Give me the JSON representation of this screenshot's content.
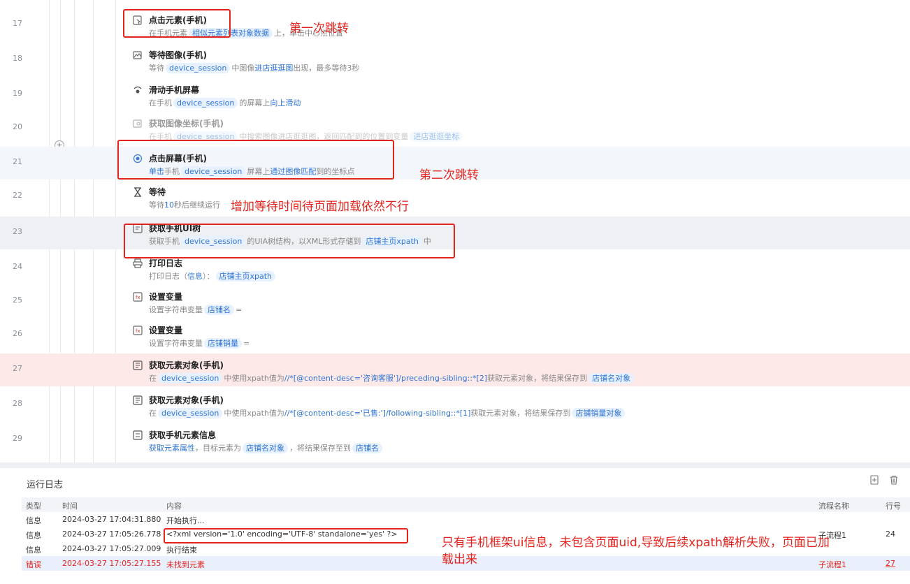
{
  "rows": [
    {
      "num": "17",
      "title": "点击元素(手机)",
      "desc_pre": "在手机元素",
      "tok1": "相似元素列表对象数据",
      "desc_post": "上，单击中心点位置"
    },
    {
      "num": "18",
      "title": "等待图像(手机)",
      "desc_pre": "等待",
      "tok1": "device_session",
      "desc_mid": "中图像",
      "kw1": "进店逛逛图",
      "desc_post": "出现，最多等待3秒"
    },
    {
      "num": "19",
      "title": "滑动手机屏幕",
      "desc_pre": "在手机",
      "tok1": "device_session",
      "desc_mid": "的屏幕上",
      "kw1": "向上滑动"
    },
    {
      "num": "20",
      "title": "获取图像坐标(手机)",
      "desc_pre": "在手机",
      "tok1": "device_session",
      "desc_mid": "中搜索图像进店逛逛图，返回匹配到的位置到变量",
      "tok2": "进店逛逛坐标"
    },
    {
      "num": "21",
      "title": "点击屏幕(手机)",
      "kw0": "单击",
      "desc_pre": "手机",
      "tok1": "device_session",
      "desc_mid": "屏幕上",
      "kw1": "通过图像匹配",
      "desc_post": "到的坐标点"
    },
    {
      "num": "22",
      "title": "等待",
      "desc_pre": "等待",
      "kw1": "10",
      "desc_post": "秒后继续运行"
    },
    {
      "num": "23",
      "title": "获取手机UI树",
      "desc_pre": "获取手机",
      "tok1": "device_session",
      "desc_mid": "的UIA树结构，以XML形式存储到",
      "tok2": "店铺主页xpath",
      "desc_post": "中"
    },
    {
      "num": "24",
      "title": "打印日志",
      "desc_pre": "打印日志（",
      "kw1": "信息",
      "desc_mid": "）：",
      "tok1": "店铺主页xpath"
    },
    {
      "num": "25",
      "title": "设置变量",
      "desc_pre": "设置字符串变量",
      "tok1": "店铺名",
      "desc_post": "="
    },
    {
      "num": "26",
      "title": "设置变量",
      "desc_pre": "设置字符串变量",
      "tok1": "店铺销量",
      "desc_post": "="
    },
    {
      "num": "27",
      "title": "获取元素对象(手机)",
      "desc_pre": "在",
      "tok1": "device_session",
      "desc_mid": "中使用xpath值为",
      "kw1": "//*[@content-desc='咨询客服']/preceding-sibling::*[2]",
      "desc_post": "获取元素对象，将结果保存到",
      "tok2": "店铺名对象"
    },
    {
      "num": "28",
      "title": "获取元素对象(手机)",
      "desc_pre": "在",
      "tok1": "device_session",
      "desc_mid": "中使用xpath值为",
      "kw1": "//*[@content-desc='已售:']/following-sibling::*[1]",
      "desc_post": "获取元素对象，将结果保存到",
      "tok2": "店铺销量对象"
    },
    {
      "num": "29",
      "title": "获取手机元素信息",
      "kw0": "获取元素属性",
      "desc_pre": "，目标元素为",
      "tok1": "店铺名对象",
      "desc_mid": "，将结果保存至到",
      "tok2": "店铺名"
    }
  ],
  "annotations": {
    "a1": "第一次跳转",
    "a2": "第二次跳转",
    "a3": "增加等待时间待页面加载依然不行",
    "a4_line1": "只有手机框架ui信息，未包含页面uid,导致后续xpath解析失败，页面已加",
    "a4_line2": "载出来"
  },
  "log": {
    "title": "运行日志",
    "headers": {
      "type": "类型",
      "time": "时间",
      "content": "内容",
      "flow": "流程名称",
      "line": "行号"
    },
    "rows": [
      {
        "type": "信息",
        "time": "2024-03-27 17:04:31.880",
        "content": "开始执行...",
        "flow": "",
        "line": ""
      },
      {
        "type": "信息",
        "time": "2024-03-27 17:05:26.778",
        "content": "<?xml version='1.0' encoding='UTF-8' standalone='yes' ?>",
        "flow": "子流程1",
        "line": "24"
      },
      {
        "type": "信息",
        "time": "2024-03-27 17:05:27.009",
        "content": "执行结束",
        "flow": "",
        "line": ""
      },
      {
        "type": "错误",
        "time": "2024-03-27 17:05:27.155",
        "content": "未找到元素",
        "flow": "子流程1",
        "line": "27"
      }
    ]
  },
  "colors": {
    "accent": "#2f74d6",
    "annotation": "#e5231d",
    "error_row": "#fde9e8"
  },
  "icons": [
    "click-element-icon",
    "wait-image-icon",
    "swipe-icon",
    "image-coord-icon",
    "tap-screen-icon",
    "hourglass-icon",
    "ui-tree-icon",
    "print-icon",
    "variable-icon",
    "variable-icon",
    "element-object-icon",
    "element-object-icon",
    "element-info-icon",
    "export-icon",
    "trash-icon",
    "plus-icon"
  ]
}
